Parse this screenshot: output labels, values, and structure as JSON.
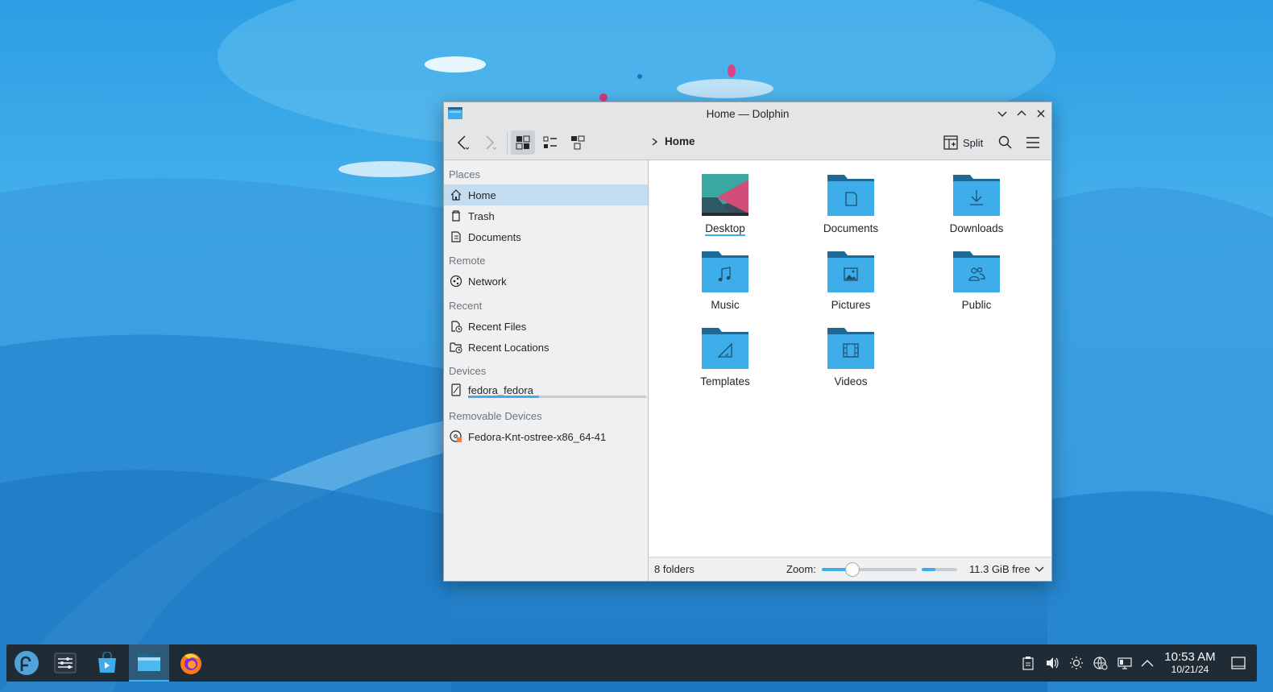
{
  "window": {
    "title": "Home — Dolphin"
  },
  "toolbar": {
    "breadcrumb": [
      "Home"
    ],
    "split_label": "Split"
  },
  "sidebar": {
    "sections": [
      {
        "header": "Places",
        "items": [
          {
            "label": "Home",
            "icon": "home-icon",
            "selected": true
          },
          {
            "label": "Trash",
            "icon": "trash-icon"
          },
          {
            "label": "Documents",
            "icon": "documents-icon"
          }
        ]
      },
      {
        "header": "Remote",
        "items": [
          {
            "label": "Network",
            "icon": "network-icon"
          }
        ]
      },
      {
        "header": "Recent",
        "items": [
          {
            "label": "Recent Files",
            "icon": "recent-files-icon"
          },
          {
            "label": "Recent Locations",
            "icon": "recent-locations-icon"
          }
        ]
      },
      {
        "header": "Devices",
        "items": [
          {
            "label": "fedora_fedora",
            "icon": "drive-icon",
            "capacity_used": 0.4
          }
        ]
      },
      {
        "header": "Removable Devices",
        "items": [
          {
            "label": "Fedora-Knt-ostree-x86_64-41",
            "icon": "optical-disc-icon"
          }
        ]
      }
    ]
  },
  "files": [
    {
      "label": "Desktop",
      "icon": "desktop-folder-icon"
    },
    {
      "label": "Documents",
      "icon": "documents-folder-icon"
    },
    {
      "label": "Downloads",
      "icon": "downloads-folder-icon"
    },
    {
      "label": "Music",
      "icon": "music-folder-icon"
    },
    {
      "label": "Pictures",
      "icon": "pictures-folder-icon"
    },
    {
      "label": "Public",
      "icon": "public-folder-icon"
    },
    {
      "label": "Templates",
      "icon": "templates-folder-icon"
    },
    {
      "label": "Videos",
      "icon": "videos-folder-icon"
    }
  ],
  "statusbar": {
    "count": "8 folders",
    "zoom_label": "Zoom:",
    "zoom_level": 0.32,
    "space_used": 0.38,
    "free": "11.3 GiB free"
  },
  "taskbar": {
    "apps": [
      "fedora-launcher-icon",
      "system-settings-icon",
      "discover-icon",
      "dolphin-icon",
      "firefox-icon"
    ],
    "clock": {
      "time": "10:53 AM",
      "date": "10/21/24"
    }
  },
  "colors": {
    "accent": "#3daee9",
    "selection": "#c4dcf0",
    "folder": "#3daee9",
    "folder_tab": "#1d6a98",
    "taskbar": "#1f2b35"
  }
}
